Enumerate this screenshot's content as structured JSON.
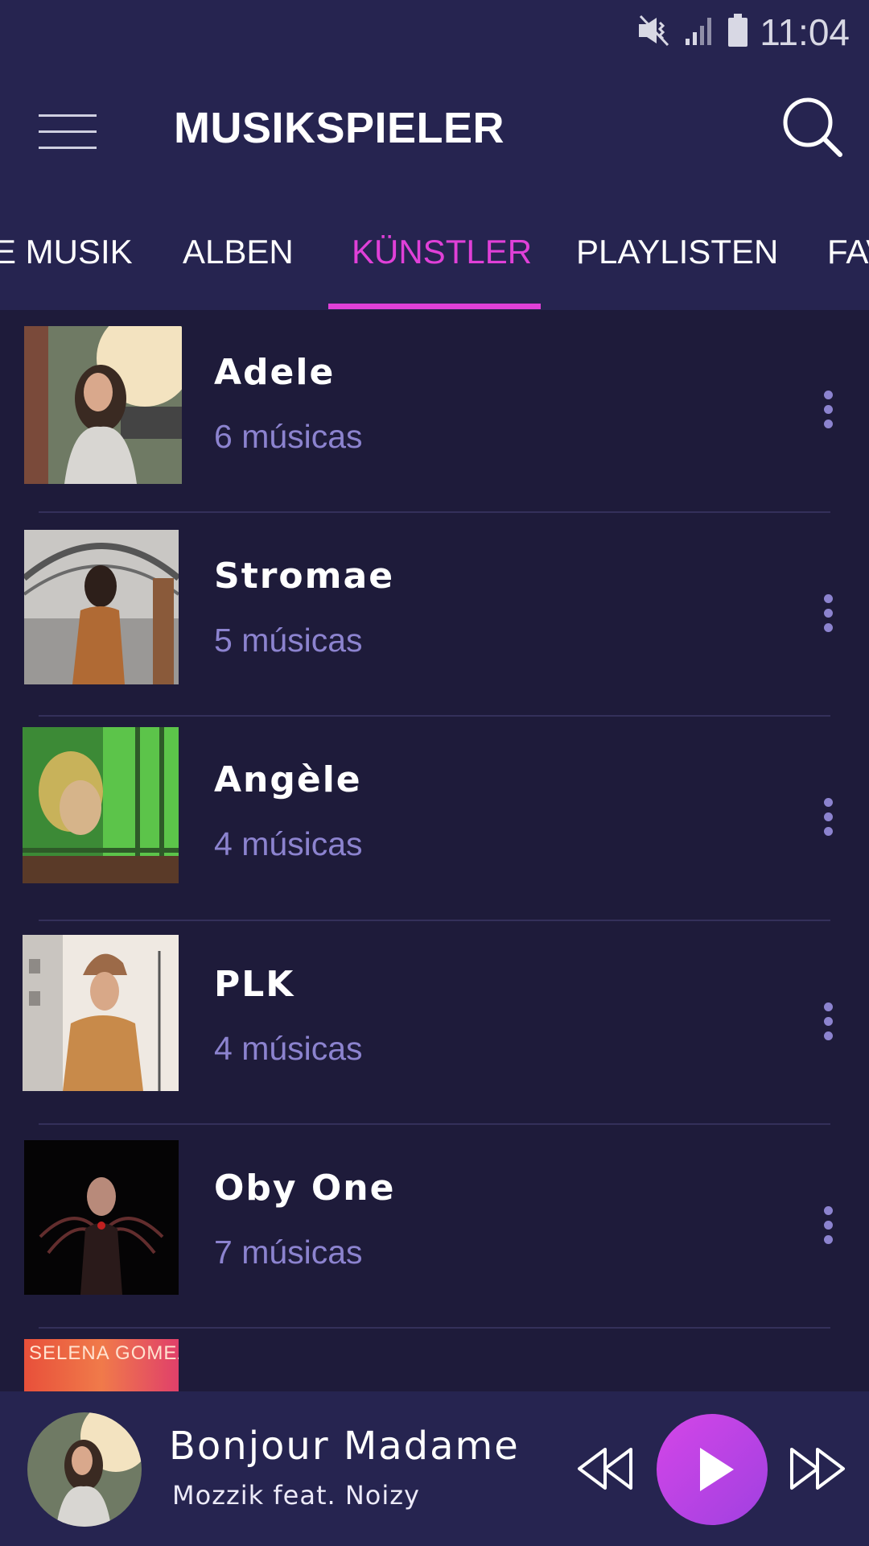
{
  "status_bar": {
    "time": "11:04",
    "icons": [
      "mute-vibrate-icon",
      "signal-icon",
      "battery-icon"
    ]
  },
  "app_bar": {
    "title": "MUSIKSPIELER",
    "menu_icon": "hamburger-menu-icon",
    "search_icon": "search-icon"
  },
  "tabs": [
    {
      "label": "E MUSIK",
      "active": false
    },
    {
      "label": "ALBEN",
      "active": false
    },
    {
      "label": "KÜNSTLER",
      "active": true
    },
    {
      "label": "PLAYLISTEN",
      "active": false
    },
    {
      "label": "FAV",
      "active": false
    }
  ],
  "artists": [
    {
      "name": "Adele",
      "count": "6 músicas"
    },
    {
      "name": "Stromae",
      "count": "5 músicas"
    },
    {
      "name": "Angèle",
      "count": "4 músicas"
    },
    {
      "name": "PLK",
      "count": "4 músicas"
    },
    {
      "name": "Oby One",
      "count": "7 músicas"
    }
  ],
  "partial_row_thumb_text": "SELENA GOMEZ",
  "now_playing": {
    "title": "Bonjour Madame",
    "artist": "Mozzik feat. Noizy"
  },
  "colors": {
    "background": "#1e1b3a",
    "header": "#262450",
    "accent": "#e040d8",
    "secondary_text": "#8c83cf"
  }
}
